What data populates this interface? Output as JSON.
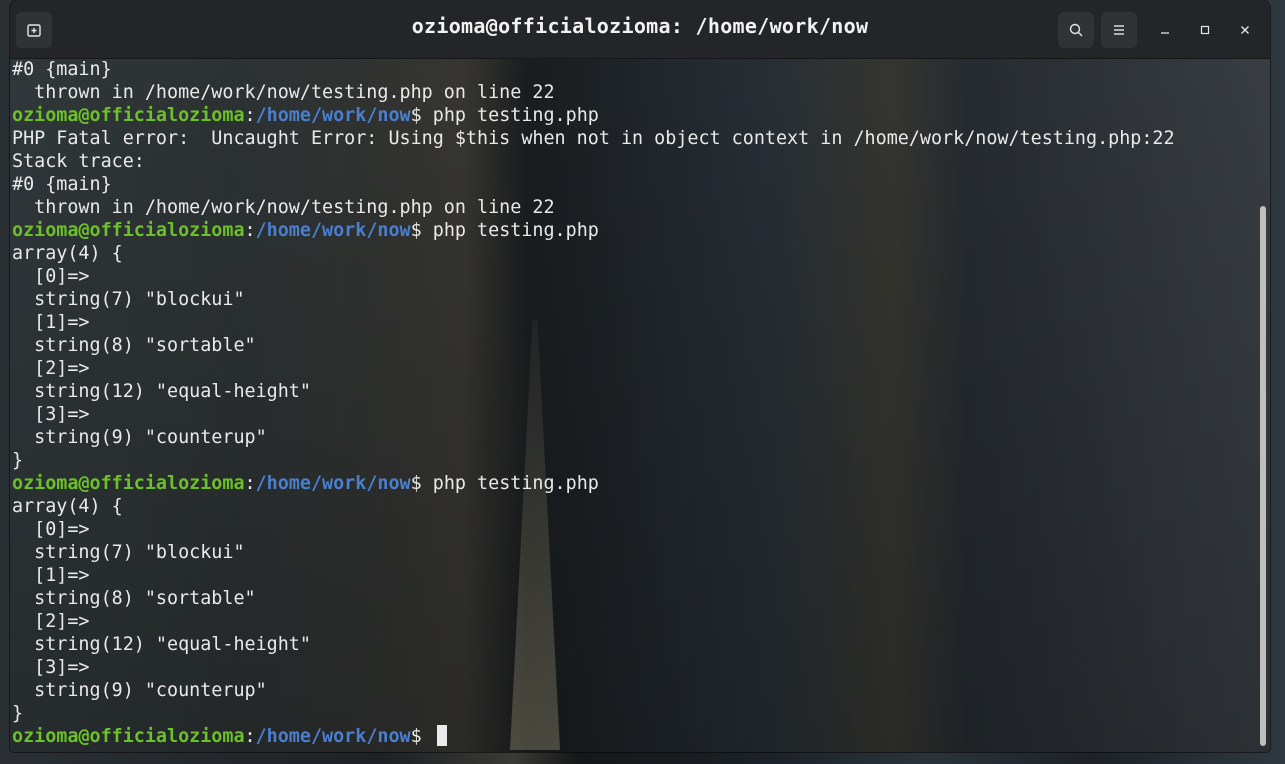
{
  "window": {
    "title": "ozioma@officialozioma: /home/work/now"
  },
  "titlebar": {
    "new_tab_icon": "new-tab-icon",
    "search_icon": "search-icon",
    "menu_icon": "hamburger-menu-icon",
    "minimize_glyph": "–",
    "maximize_glyph": "□",
    "close_glyph": "×"
  },
  "colors": {
    "prompt_user": "#6cc12a",
    "prompt_path": "#4a7fd0",
    "text": "#e9e9e9"
  },
  "terminal": {
    "lines": [
      {
        "type": "text",
        "text": "#0 {main}"
      },
      {
        "type": "text",
        "text": "  thrown in /home/work/now/testing.php on line 22"
      },
      {
        "type": "prompt",
        "user": "ozioma@officialozioma",
        "path": "/home/work/now",
        "command": "php testing.php"
      },
      {
        "type": "text",
        "text": "PHP Fatal error:  Uncaught Error: Using $this when not in object context in /home/work/now/testing.php:22"
      },
      {
        "type": "text",
        "text": "Stack trace:"
      },
      {
        "type": "text",
        "text": "#0 {main}"
      },
      {
        "type": "text",
        "text": "  thrown in /home/work/now/testing.php on line 22"
      },
      {
        "type": "prompt",
        "user": "ozioma@officialozioma",
        "path": "/home/work/now",
        "command": "php testing.php"
      },
      {
        "type": "text",
        "text": "array(4) {"
      },
      {
        "type": "text",
        "text": "  [0]=>"
      },
      {
        "type": "text",
        "text": "  string(7) \"blockui\""
      },
      {
        "type": "text",
        "text": "  [1]=>"
      },
      {
        "type": "text",
        "text": "  string(8) \"sortable\""
      },
      {
        "type": "text",
        "text": "  [2]=>"
      },
      {
        "type": "text",
        "text": "  string(12) \"equal-height\""
      },
      {
        "type": "text",
        "text": "  [3]=>"
      },
      {
        "type": "text",
        "text": "  string(9) \"counterup\""
      },
      {
        "type": "text",
        "text": "}"
      },
      {
        "type": "prompt",
        "user": "ozioma@officialozioma",
        "path": "/home/work/now",
        "command": "php testing.php"
      },
      {
        "type": "text",
        "text": "array(4) {"
      },
      {
        "type": "text",
        "text": "  [0]=>"
      },
      {
        "type": "text",
        "text": "  string(7) \"blockui\""
      },
      {
        "type": "text",
        "text": "  [1]=>"
      },
      {
        "type": "text",
        "text": "  string(8) \"sortable\""
      },
      {
        "type": "text",
        "text": "  [2]=>"
      },
      {
        "type": "text",
        "text": "  string(12) \"equal-height\""
      },
      {
        "type": "text",
        "text": "  [3]=>"
      },
      {
        "type": "text",
        "text": "  string(9) \"counterup\""
      },
      {
        "type": "text",
        "text": "}"
      },
      {
        "type": "prompt",
        "user": "ozioma@officialozioma",
        "path": "/home/work/now",
        "command": "",
        "cursor": true
      }
    ]
  }
}
